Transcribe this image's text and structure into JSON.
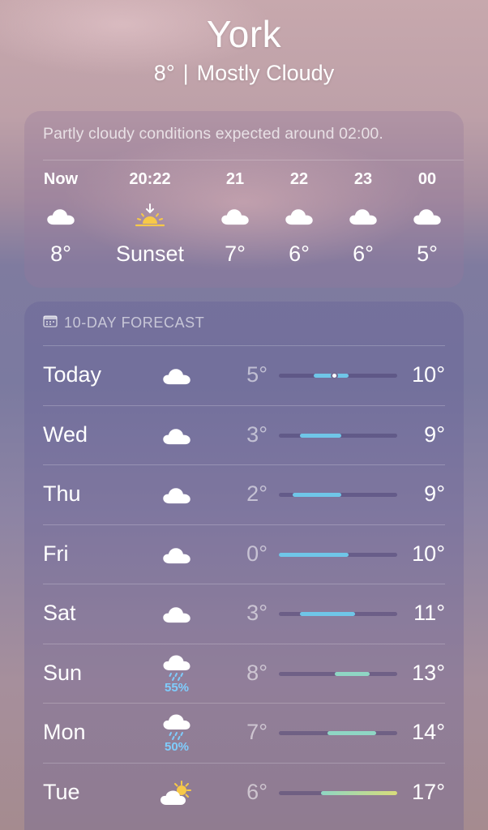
{
  "location": {
    "city": "York",
    "temperature": "8°",
    "condition": "Mostly Cloudy"
  },
  "hourly": {
    "note": "Partly cloudy conditions expected around 02:00.",
    "items": [
      {
        "label": "Now",
        "icon": "cloud-icon",
        "temp": "8°"
      },
      {
        "label": "20:22",
        "icon": "sunset-icon",
        "temp": "Sunset"
      },
      {
        "label": "21",
        "icon": "cloud-icon",
        "temp": "7°"
      },
      {
        "label": "22",
        "icon": "cloud-icon",
        "temp": "6°"
      },
      {
        "label": "23",
        "icon": "cloud-icon",
        "temp": "6°"
      },
      {
        "label": "00",
        "icon": "cloud-icon",
        "temp": "5°"
      }
    ]
  },
  "forecast": {
    "title": "10-DAY FORECAST",
    "range": {
      "min": 0,
      "max": 17
    },
    "current_temp": 8,
    "days": [
      {
        "day": "Today",
        "icon": "cloud-icon",
        "precip": "",
        "low": "5°",
        "high": "10°",
        "low_value": 5,
        "high_value": 10
      },
      {
        "day": "Wed",
        "icon": "cloud-icon",
        "precip": "",
        "low": "3°",
        "high": "9°",
        "low_value": 3,
        "high_value": 9
      },
      {
        "day": "Thu",
        "icon": "cloud-icon",
        "precip": "",
        "low": "2°",
        "high": "9°",
        "low_value": 2,
        "high_value": 9
      },
      {
        "day": "Fri",
        "icon": "cloud-icon",
        "precip": "",
        "low": "0°",
        "high": "10°",
        "low_value": 0,
        "high_value": 10
      },
      {
        "day": "Sat",
        "icon": "cloud-icon",
        "precip": "",
        "low": "3°",
        "high": "11°",
        "low_value": 3,
        "high_value": 11
      },
      {
        "day": "Sun",
        "icon": "rain-cloud-icon",
        "precip": "55%",
        "low": "8°",
        "high": "13°",
        "low_value": 8,
        "high_value": 13
      },
      {
        "day": "Mon",
        "icon": "rain-cloud-icon",
        "precip": "50%",
        "low": "7°",
        "high": "14°",
        "low_value": 7,
        "high_value": 14
      },
      {
        "day": "Tue",
        "icon": "partly-sunny-icon",
        "precip": "",
        "low": "6°",
        "high": "17°",
        "low_value": 6,
        "high_value": 17
      }
    ]
  },
  "colors": {
    "cool": "#6fc6e8",
    "mild": "#8fd6c4",
    "warm": "#d8dd7a",
    "precip": "#7fcdfd",
    "sun": "#f7c948"
  }
}
